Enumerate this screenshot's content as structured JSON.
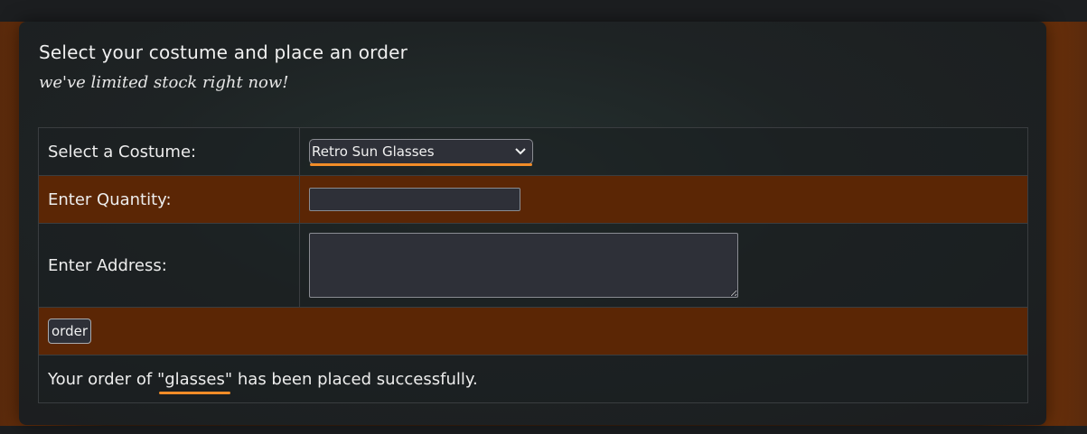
{
  "header": {
    "title": "Select your costume and place an order",
    "subtitle": "we've limited stock right now!"
  },
  "form": {
    "costume_label": "Select a Costume:",
    "costume_selected": "Retro Sun Glasses",
    "quantity_label": "Enter Quantity:",
    "quantity_value": "",
    "address_label": "Enter Address:",
    "address_value": "",
    "order_button": "order"
  },
  "message": {
    "prefix": "Your order of ",
    "item": "\"glasses\"",
    "suffix": " has been placed successfully."
  },
  "colors": {
    "accent": "#f28c28",
    "row_highlight": "#5b2605",
    "panel_bg": "#1b1d1f"
  },
  "icons": {
    "select_chevron": "chevron-down-icon"
  }
}
